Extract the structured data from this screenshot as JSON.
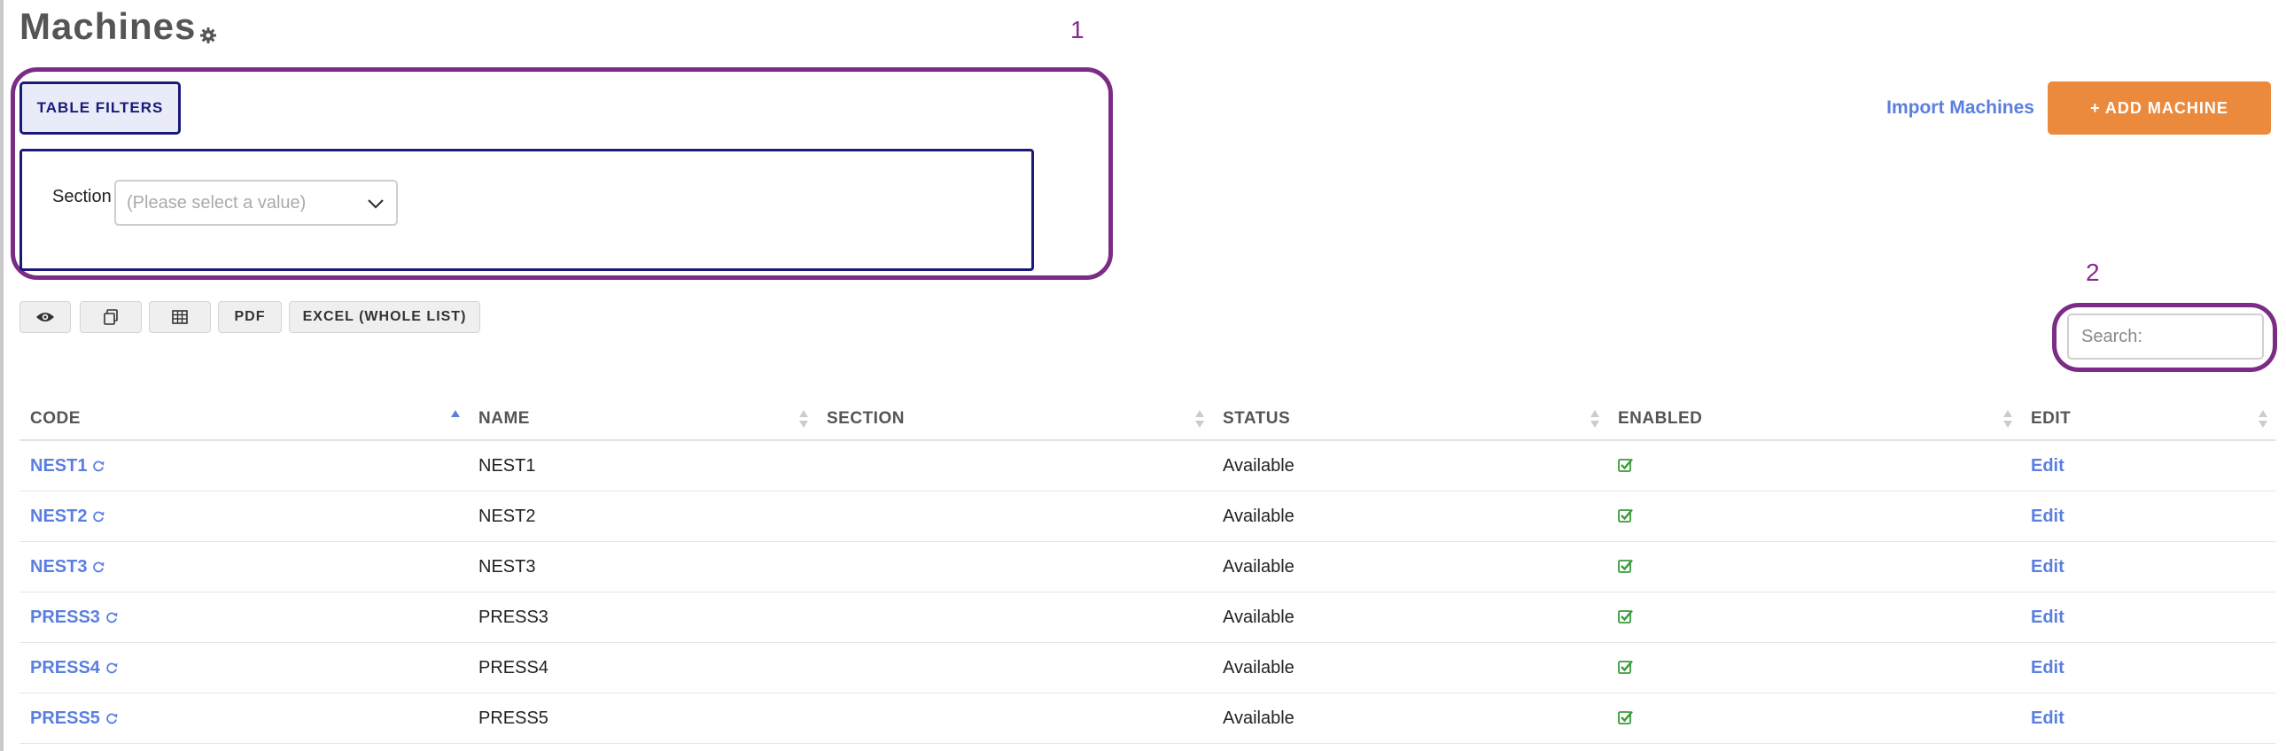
{
  "page": {
    "title": "Machines"
  },
  "annotations": {
    "one": "1",
    "two": "2"
  },
  "filters": {
    "button_label": "TABLE FILTERS",
    "section_label": "Section",
    "section_placeholder": "(Please select a value)"
  },
  "actions": {
    "import_label": "Import Machines",
    "add_label": "+ ADD MACHINE"
  },
  "toolbar": {
    "pdf_label": "PDF",
    "excel_label": "EXCEL (WHOLE LIST)"
  },
  "search": {
    "placeholder": "Search:"
  },
  "table": {
    "headers": [
      "CODE",
      "NAME",
      "SECTION",
      "STATUS",
      "ENABLED",
      "EDIT"
    ],
    "rows": [
      {
        "code": "NEST1",
        "name": "NEST1",
        "section": "",
        "status": "Available",
        "edit": "Edit"
      },
      {
        "code": "NEST2",
        "name": "NEST2",
        "section": "",
        "status": "Available",
        "edit": "Edit"
      },
      {
        "code": "NEST3",
        "name": "NEST3",
        "section": "",
        "status": "Available",
        "edit": "Edit"
      },
      {
        "code": "PRESS3",
        "name": "PRESS3",
        "section": "",
        "status": "Available",
        "edit": "Edit"
      },
      {
        "code": "PRESS4",
        "name": "PRESS4",
        "section": "",
        "status": "Available",
        "edit": "Edit"
      },
      {
        "code": "PRESS5",
        "name": "PRESS5",
        "section": "",
        "status": "Available",
        "edit": "Edit"
      }
    ]
  },
  "colors": {
    "link": "#5a7fe0",
    "accent_orange": "#eb8a3c",
    "annotation_purple": "#7b2d86",
    "filter_navy": "#1a1a7a",
    "check_green": "#3a9a3a"
  }
}
